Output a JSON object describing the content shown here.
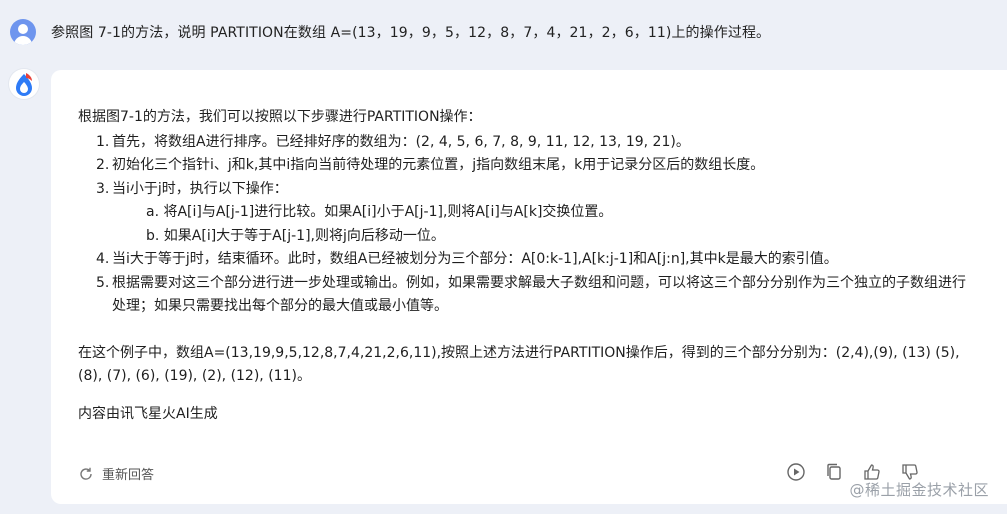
{
  "question": {
    "text": "参照图 7-1的方法，说明 PARTITION在数组 A=(13，19，9，5，12，8，7，4，21，2，6，11)上的操作过程。"
  },
  "answer": {
    "intro": "根据图7-1的方法，我们可以按照以下步骤进行PARTITION操作：",
    "steps": [
      {
        "num": "1.",
        "text": "首先，将数组A进行排序。已经排好序的数组为：(2, 4, 5, 6, 7, 8, 9, 11, 12, 13, 19, 21)。"
      },
      {
        "num": "2.",
        "text": "初始化三个指针i、j和k,其中i指向当前待处理的元素位置，j指向数组末尾，k用于记录分区后的数组长度。"
      },
      {
        "num": "3.",
        "text": "当i小于j时，执行以下操作："
      },
      {
        "num": "4.",
        "text": "当i大于等于j时，结束循环。此时，数组A已经被划分为三个部分：A[0:k-1],A[k:j-1]和A[j:n],其中k是最大的索引值。"
      },
      {
        "num": "5.",
        "text": "根据需要对这三个部分进行进一步处理或输出。例如，如果需要求解最大子数组和问题，可以将这三个部分分别作为三个独立的子数组进行处理；如果只需要找出每个部分的最大值或最小值等。"
      }
    ],
    "substeps": [
      "a. 将A[i]与A[j-1]进行比较。如果A[i]小于A[j-1],则将A[i]与A[k]交换位置。",
      "b. 如果A[i]大于等于A[j-1],则将j向后移动一位。"
    ],
    "conclusion": "在这个例子中，数组A=(13,19,9,5,12,8,7,4,21,2,6,11),按照上述方法进行PARTITION操作后，得到的三个部分分别为：(2,4),(9), (13) (5), (8), (7), (6), (19), (2), (12), (11)。",
    "source": "内容由讯飞星火AI生成"
  },
  "footer": {
    "regenerate_label": "重新回答",
    "icons": [
      "play-icon",
      "copy-icon",
      "thumbs-up-icon",
      "thumbs-down-icon"
    ]
  },
  "watermark": "@稀土掘金技术社区",
  "colors": {
    "page_bg": "#edf0f7",
    "card_bg": "#ffffff",
    "user_avatar": "#6e95ee",
    "bot_blue": "#2e7bf6",
    "bot_red": "#e8413a"
  }
}
